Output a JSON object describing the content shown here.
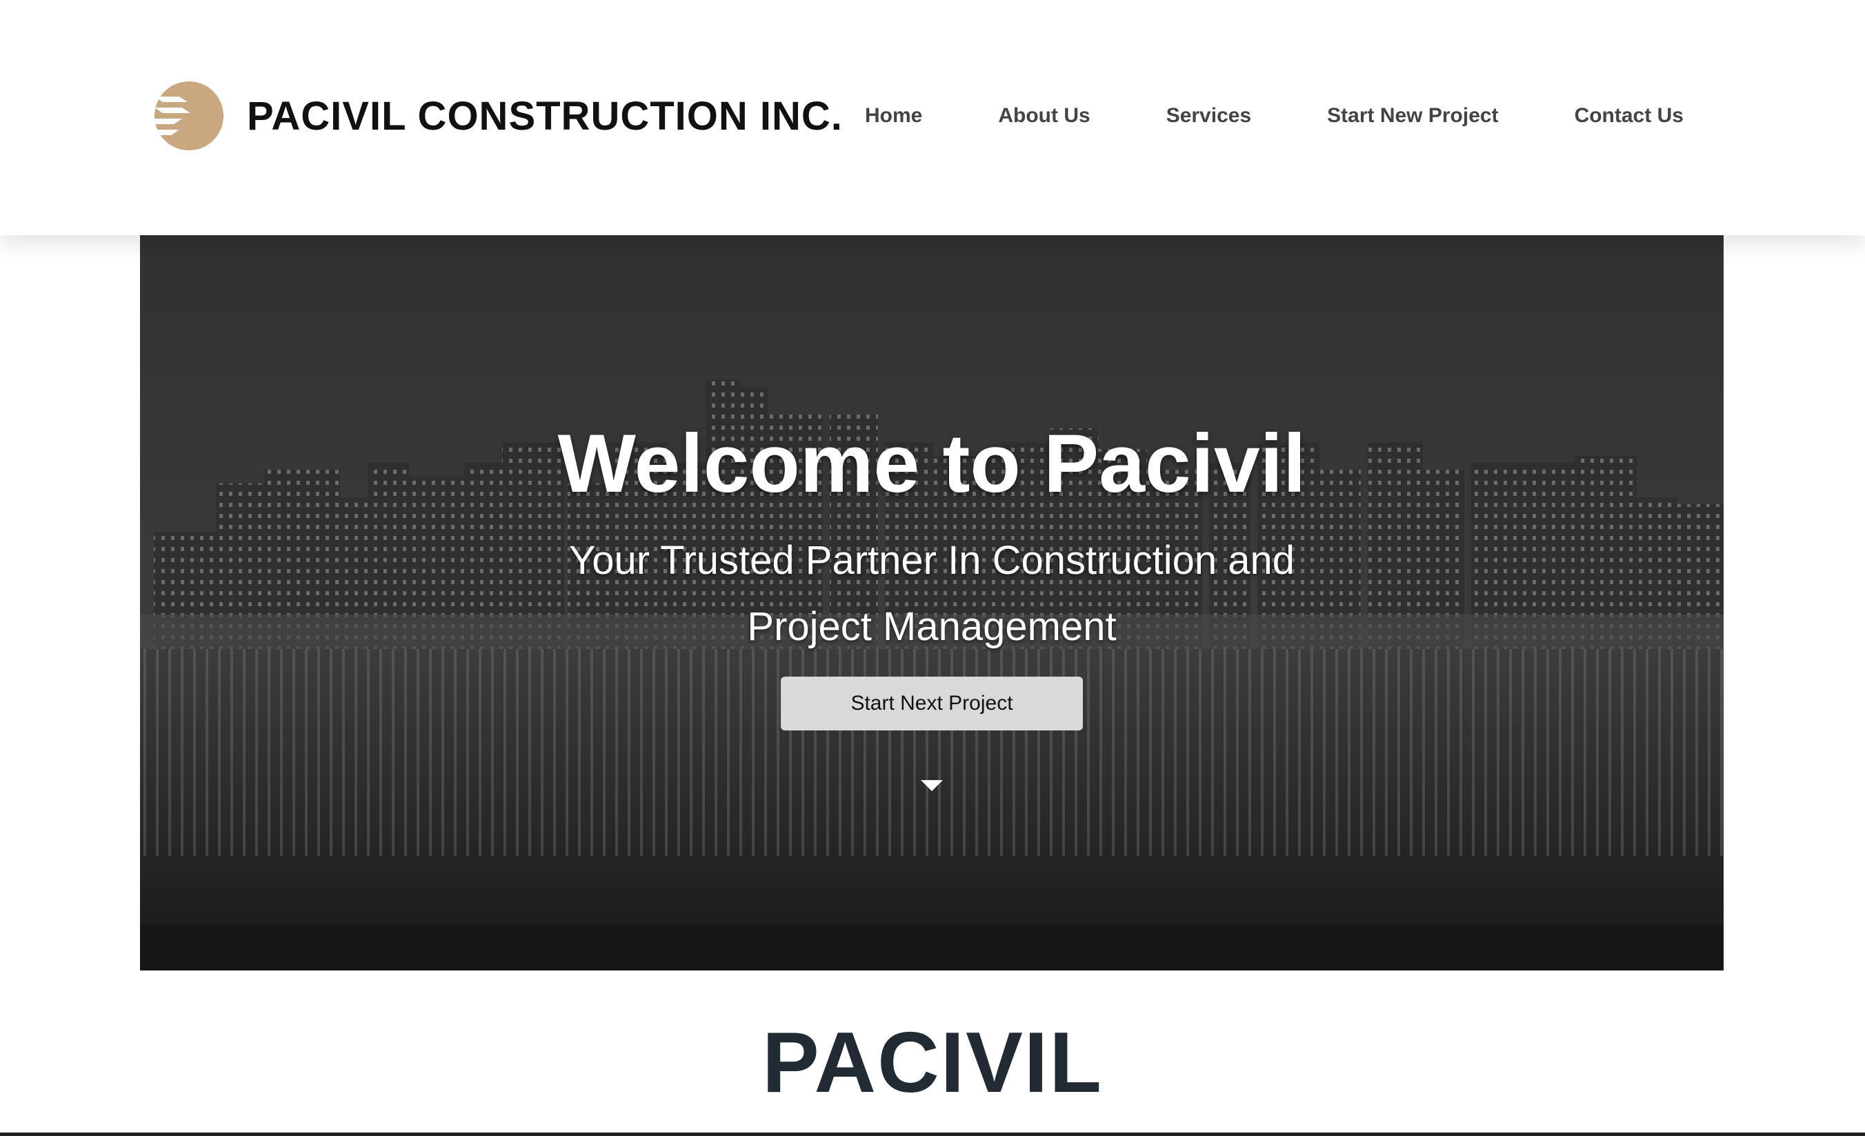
{
  "header": {
    "brand_name": "PACIVIL CONSTRUCTION INC.",
    "logo_icon": "stacked-chevrons-logo",
    "logo_color": "#c9a77f",
    "nav": [
      {
        "label": "Home"
      },
      {
        "label": "About Us"
      },
      {
        "label": "Services"
      },
      {
        "label": "Start New Project"
      },
      {
        "label": "Contact Us"
      }
    ]
  },
  "hero": {
    "title": "Welcome to Pacivil",
    "subtitle_line1": "Your Trusted Partner In Construction and",
    "subtitle_line2": "Project Management",
    "cta_label": "Start Next Project",
    "scroll_icon": "caret-down-icon",
    "background_image": "city-skyline-waterfront-night-monochrome"
  },
  "section": {
    "title": "PACIVIL"
  }
}
